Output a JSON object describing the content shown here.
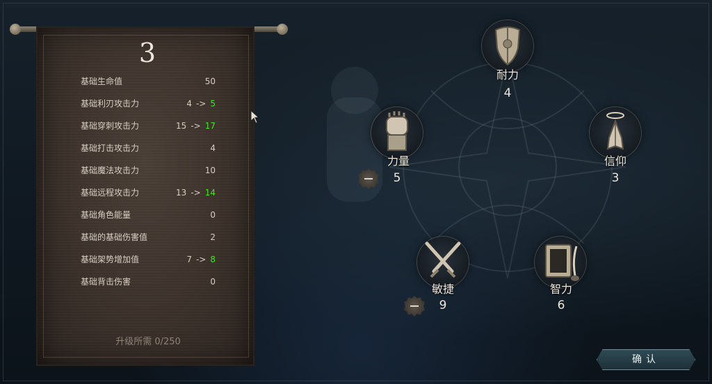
{
  "level": "3",
  "stats": [
    {
      "name": "基础生命值",
      "value": "50",
      "new": null
    },
    {
      "name": "基础利刃攻击力",
      "value": "4",
      "new": "5"
    },
    {
      "name": "基础穿刺攻击力",
      "value": "15",
      "new": "17"
    },
    {
      "name": "基础打击攻击力",
      "value": "4",
      "new": null
    },
    {
      "name": "基础魔法攻击力",
      "value": "10",
      "new": null
    },
    {
      "name": "基础远程攻击力",
      "value": "13",
      "new": "14"
    },
    {
      "name": "基础角色能量",
      "value": "0",
      "new": null
    },
    {
      "name": "基础的基础伤害值",
      "value": "2",
      "new": null
    },
    {
      "name": "基础架势增加值",
      "value": "7",
      "new": "8"
    },
    {
      "name": "基础背击伤害",
      "value": "0",
      "new": null
    }
  ],
  "arrow": "->",
  "upgrade_text": "升级所需 0/250",
  "attributes": {
    "endurance": {
      "name": "耐力",
      "value": "4",
      "icon": "shield-icon"
    },
    "strength": {
      "name": "力量",
      "value": "5",
      "icon": "fist-icon"
    },
    "faith": {
      "name": "信仰",
      "value": "3",
      "icon": "praying-hands-icon"
    },
    "agility": {
      "name": "敏捷",
      "value": "9",
      "icon": "crossed-daggers-icon"
    },
    "intelligence": {
      "name": "智力",
      "value": "6",
      "icon": "book-quill-icon"
    }
  },
  "confirm_label": "确认",
  "colors": {
    "increase": "#4ddc3a",
    "banner": "#3a302a",
    "button": "#2f4a55"
  }
}
